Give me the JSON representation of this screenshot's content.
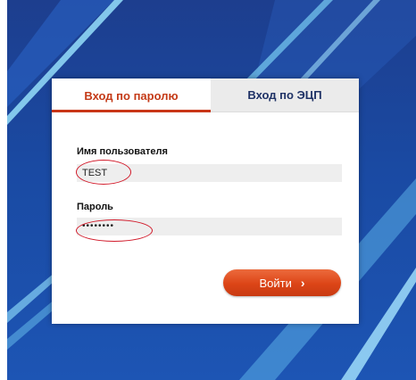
{
  "tabs": {
    "password_login": "Вход по паролю",
    "eds_login": "Вход по ЭЦП"
  },
  "form": {
    "username_label": "Имя пользователя",
    "username_value": "TEST",
    "password_label": "Пароль",
    "password_value": "••••••••",
    "submit_label": "Войти",
    "submit_icon": "chevron-right-icon"
  },
  "colors": {
    "accent": "#dc4517",
    "tab_active_text": "#c43a17",
    "tab_inactive_text": "#1f3266",
    "background": "#1a4aa3",
    "annotation": "#d11a2a"
  }
}
